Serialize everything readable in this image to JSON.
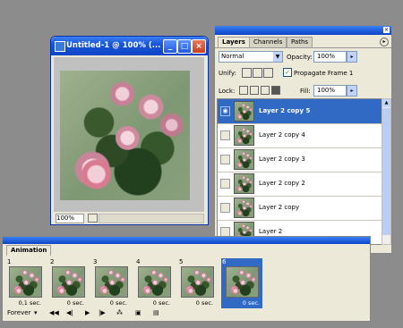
{
  "doc_window": {
    "title": "Untitled-1 @ 100% (...",
    "zoom": "100%"
  },
  "layers_panel": {
    "tabs": [
      "Layers",
      "Channels",
      "Paths"
    ],
    "blend_mode": "Normal",
    "opacity_label": "Opacity:",
    "opacity_value": "100%",
    "unify_label": "Unify:",
    "propagate_label": "Propagate Frame 1",
    "lock_label": "Lock:",
    "fill_label": "Fill:",
    "fill_value": "100%",
    "layers": [
      "Layer 2 copy 5",
      "Layer 2 copy 4",
      "Layer 2 copy 3",
      "Layer 2 copy 2",
      "Layer 2 copy",
      "Layer 2"
    ]
  },
  "animation_panel": {
    "tab": "Animation",
    "frames": [
      {
        "num": "1",
        "time": "0,1 sec."
      },
      {
        "num": "2",
        "time": "0 sec."
      },
      {
        "num": "3",
        "time": "0 sec."
      },
      {
        "num": "4",
        "time": "0 sec."
      },
      {
        "num": "5",
        "time": "0 sec."
      },
      {
        "num": "6",
        "time": "0 sec."
      }
    ],
    "loop": "Forever"
  }
}
